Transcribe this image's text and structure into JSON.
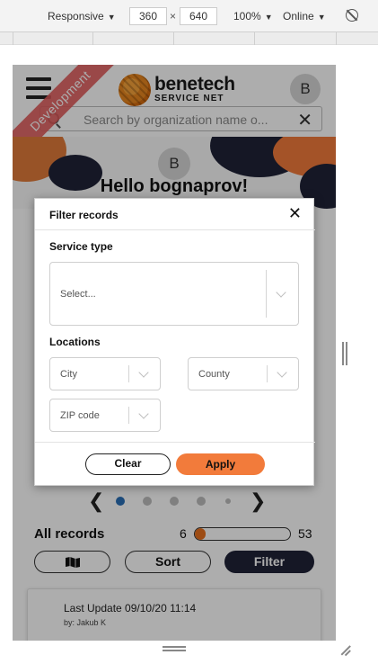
{
  "devtools": {
    "device_mode": "Responsive",
    "width": "360",
    "height": "640",
    "times": "×",
    "zoom": "100%",
    "network": "Online",
    "caret": "▼"
  },
  "header": {
    "brand_name": "benetech",
    "brand_sub": "SERVICE NET",
    "avatar_initial": "B",
    "search_placeholder": "Search by organization name o...",
    "clear_symbol": "✕",
    "ribbon": "Development"
  },
  "greeting": {
    "avatar_initial": "B",
    "text": "Hello bognaprov!"
  },
  "modal": {
    "title": "Filter records",
    "close_symbol": "✕",
    "service_type_label": "Service type",
    "service_type_value": "Select...",
    "locations_label": "Locations",
    "city_value": "City",
    "county_value": "County",
    "zip_value": "ZIP code",
    "clear_label": "Clear",
    "apply_label": "Apply"
  },
  "pager": {
    "prev": "❮",
    "next": "❯",
    "dot_count": 5,
    "active_index": 0
  },
  "records": {
    "title": "All records",
    "min": "6",
    "max": "53",
    "fill_fraction": 0.11
  },
  "actions": {
    "sort_label": "Sort",
    "filter_label": "Filter"
  },
  "card": {
    "last_update": "Last Update 09/10/20 11:14",
    "by": "by: Jakub K"
  },
  "colors": {
    "accent": "#f27b3b",
    "dark_button": "#1f2237",
    "ribbon": "#e05a5a",
    "active_dot": "#2a6fb5"
  }
}
